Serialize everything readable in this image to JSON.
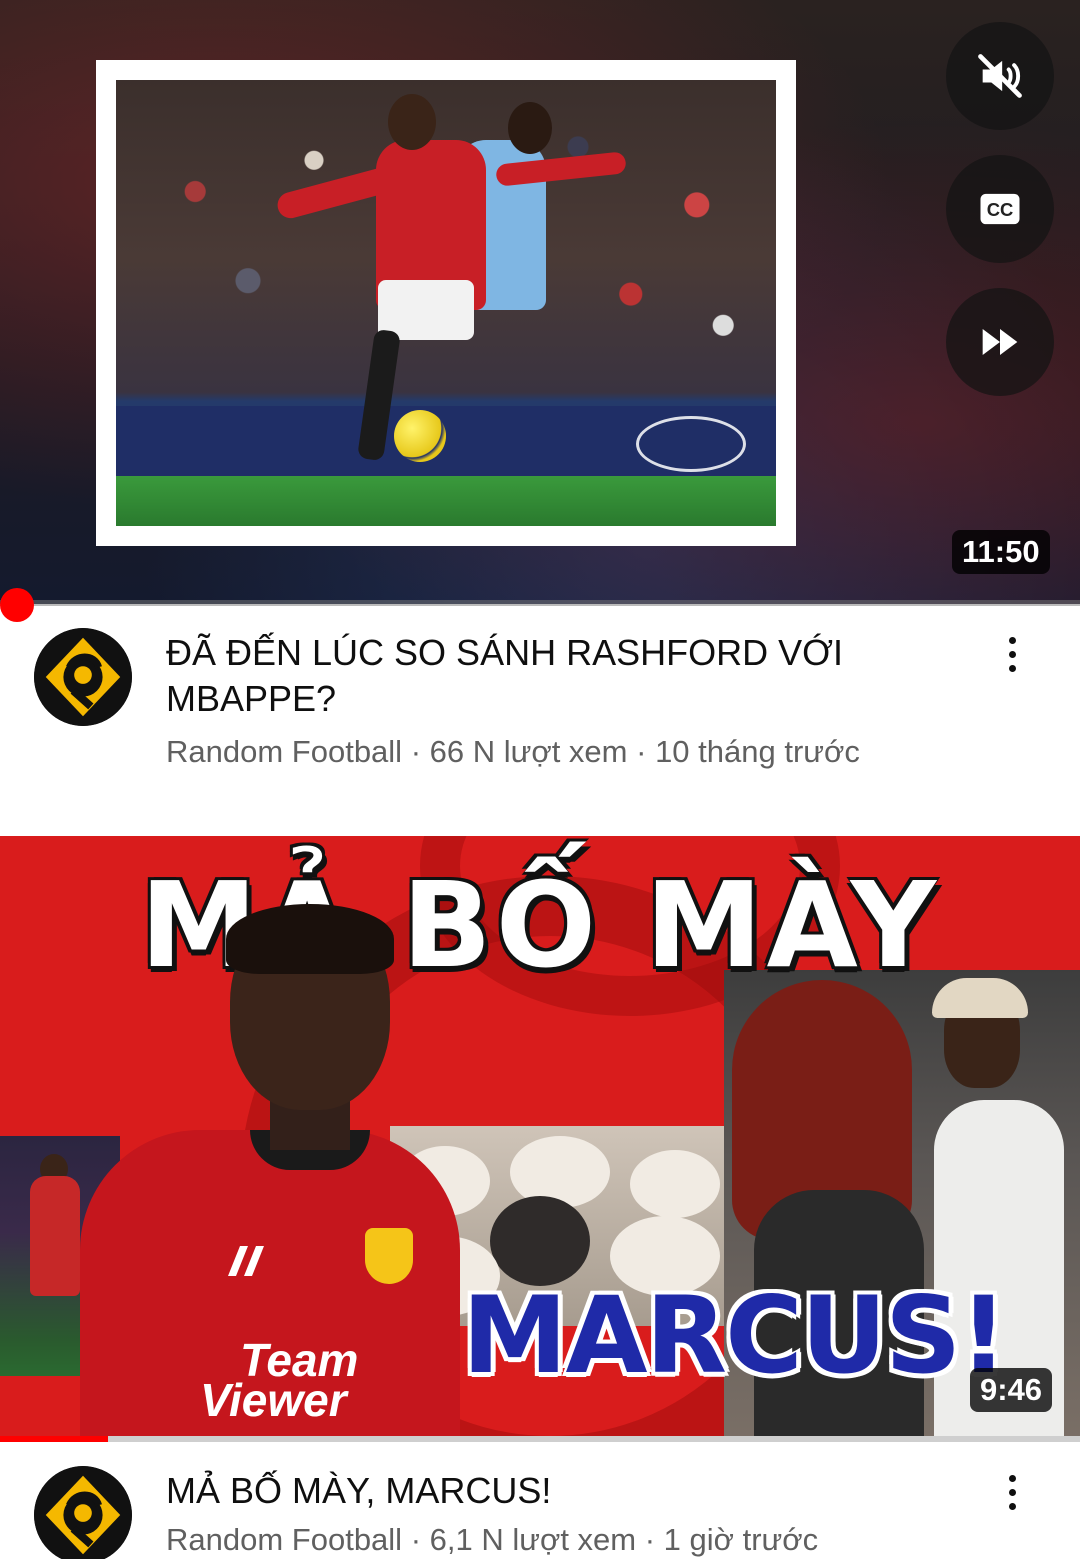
{
  "videos": [
    {
      "title": "ĐÃ ĐẾN LÚC SO SÁNH RASHFORD VỚI MBAPPE?",
      "channel": "Random Football",
      "views": "66 N lượt xem",
      "age": "10 tháng trước",
      "duration": "11:50",
      "separator": " · ",
      "controls": {
        "mute_icon": "volume-muted-icon",
        "cc_label": "CC",
        "skip_icon": "fast-forward-icon"
      }
    },
    {
      "title": "MẢ BỐ MÀY, MARCUS!",
      "channel": "Random Football",
      "views": "6,1 N lượt xem",
      "age": "1 giờ trước",
      "duration": "9:46",
      "separator": " · ",
      "thumbnail_text": {
        "headline": "MẢ BỐ MÀY",
        "name": "MARCUS!",
        "sponsor_line1": "Team",
        "sponsor_line2": "Viewer"
      },
      "watched_fraction": 0.1
    }
  ],
  "colors": {
    "accent": "#ff0000",
    "channel_avatar_bg": "#111111",
    "channel_avatar_fg": "#f5b800",
    "thumb2_bg": "#d91c1c",
    "marcus_text": "#1f2aa8"
  }
}
